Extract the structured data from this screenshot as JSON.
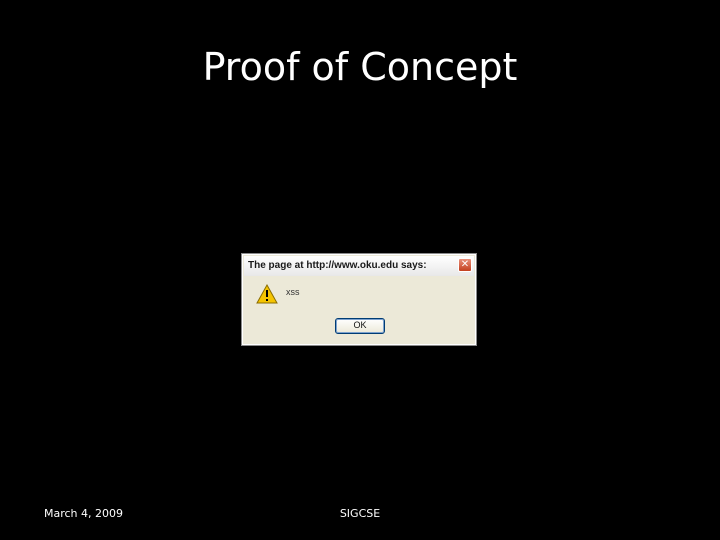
{
  "slide": {
    "title": "Proof of Concept",
    "footer_date": "March 4, 2009",
    "footer_center": "SIGCSE",
    "background_color": "#000000",
    "text_color": "#ffffff"
  },
  "dialog": {
    "title": "The page at http://www.oku.edu says:",
    "message": "xss",
    "ok_label": "OK",
    "icon": "warning-icon",
    "close_icon": "close-icon"
  }
}
